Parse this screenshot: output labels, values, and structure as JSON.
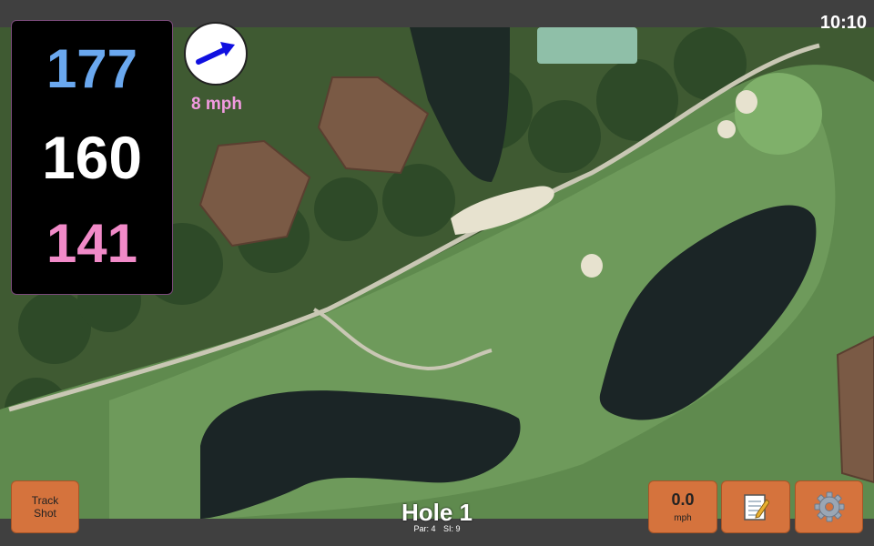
{
  "status": {
    "time": "10:10"
  },
  "distances": {
    "back": "177",
    "center": "160",
    "front": "141"
  },
  "wind": {
    "speed_label": "8 mph",
    "direction_icon": "arrow-right-icon"
  },
  "hole": {
    "title": "Hole 1",
    "par_label": "Par: 4",
    "si_label": "SI: 9"
  },
  "buttons": {
    "track_shot_line1": "Track",
    "track_shot_line2": "Shot",
    "wind_value": "0.0",
    "wind_unit": "mph",
    "notes_icon": "notepad-icon",
    "settings_icon": "gear-icon"
  },
  "colors": {
    "back_distance": "#6aa8ef",
    "center_distance": "#ffffff",
    "front_distance": "#f18ac8",
    "wind_label": "#f19ae0",
    "button_bg": "#d5733d",
    "arrow": "#1010e0"
  }
}
